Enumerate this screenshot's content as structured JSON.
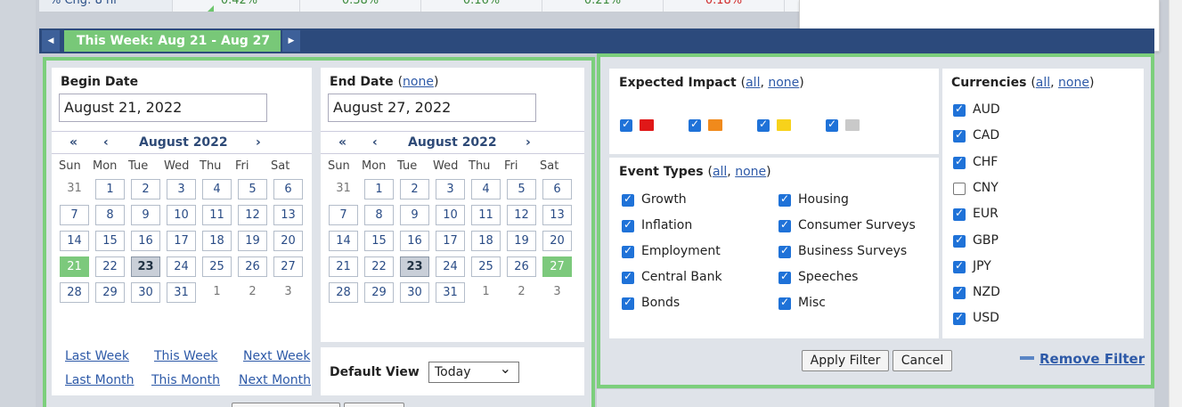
{
  "top_strip": {
    "label": "% Chg: 8 hr",
    "values": [
      {
        "text": "0.42%",
        "color": "#3b8a3b"
      },
      {
        "text": "0.38%",
        "color": "#3b8a3b"
      },
      {
        "text": "0.16%",
        "color": "#3b8a3b"
      },
      {
        "text": "0.21%",
        "color": "#3b8a3b"
      },
      {
        "text": "0.18%",
        "color": "#d02b2b"
      }
    ]
  },
  "week_bar": {
    "label": "This Week: Aug 21 - Aug 27",
    "prev_icon": "arrow-left-icon",
    "next_icon": "arrow-right-icon"
  },
  "begin": {
    "title": "Begin Date",
    "value": "August 21, 2022",
    "month_label": "August 2022",
    "nav": {
      "prev_year": "«",
      "prev_month": "‹",
      "next_month": "›"
    }
  },
  "end": {
    "title": "End Date",
    "none_link": "none",
    "value": "August 27, 2022",
    "month_label": "August 2022",
    "nav": {
      "prev_year": "«",
      "prev_month": "‹",
      "next_month": "›"
    }
  },
  "weekdays": [
    "Sun",
    "Mon",
    "Tue",
    "Wed",
    "Thu",
    "Fri",
    "Sat"
  ],
  "quick_links": {
    "last_week": "Last Week",
    "this_week": "This Week",
    "next_week": "Next Week",
    "last_month": "Last Month",
    "this_month": "This Month",
    "next_month": "Next Month"
  },
  "default_view": {
    "label": "Default View",
    "selected": "Today"
  },
  "impact": {
    "title": "Expected Impact",
    "all_link": "all",
    "none_link": "none",
    "levels": [
      {
        "name": "high",
        "color": "#e01818"
      },
      {
        "name": "medium",
        "color": "#f08a1c"
      },
      {
        "name": "low",
        "color": "#f7d21b"
      },
      {
        "name": "non-economic",
        "color": "#c9c9c9"
      }
    ]
  },
  "event_types": {
    "title": "Event Types",
    "all_link": "all",
    "none_link": "none",
    "col1": [
      "Growth",
      "Inflation",
      "Employment",
      "Central Bank",
      "Bonds"
    ],
    "col2": [
      "Housing",
      "Consumer Surveys",
      "Business Surveys",
      "Speeches",
      "Misc"
    ]
  },
  "currencies": {
    "title": "Currencies",
    "all_link": "all",
    "none_link": "none",
    "items": [
      {
        "code": "AUD",
        "checked": true
      },
      {
        "code": "CAD",
        "checked": true
      },
      {
        "code": "CHF",
        "checked": true
      },
      {
        "code": "CNY",
        "checked": false
      },
      {
        "code": "EUR",
        "checked": true
      },
      {
        "code": "GBP",
        "checked": true
      },
      {
        "code": "JPY",
        "checked": true
      },
      {
        "code": "NZD",
        "checked": true
      },
      {
        "code": "USD",
        "checked": true
      }
    ]
  },
  "buttons": {
    "apply": "Apply Filter",
    "cancel": "Cancel",
    "remove": "Remove Filter"
  }
}
